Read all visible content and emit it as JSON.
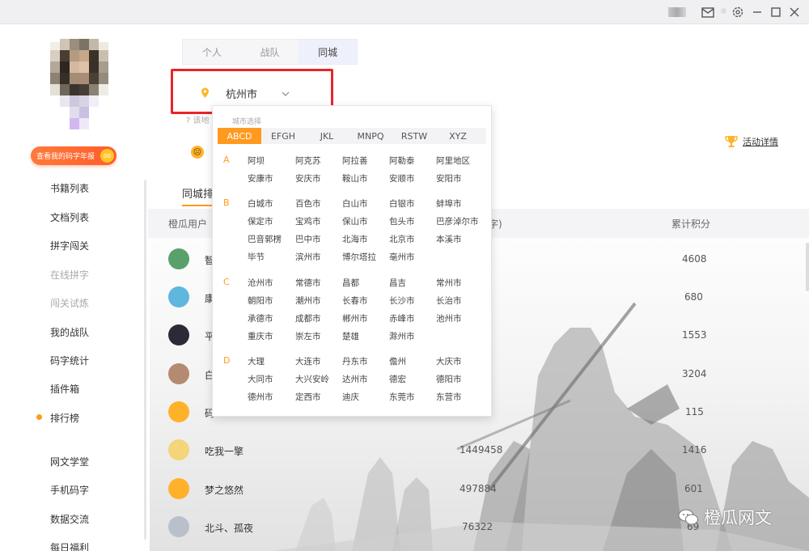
{
  "titlebar": {
    "icons": [
      "user-thumb-icon",
      "mail-icon",
      "settings-icon",
      "minimize-icon",
      "maximize-icon",
      "close-icon"
    ]
  },
  "sidebar": {
    "annual_report_label": "查看我的码字年报",
    "annual_badge": "00",
    "nav": [
      {
        "label": "书籍列表",
        "dim": false
      },
      {
        "label": "文档列表",
        "dim": false
      },
      {
        "label": "拼字闯关",
        "dim": false
      },
      {
        "label": "在线拼字",
        "dim": true
      },
      {
        "label": "闯关试炼",
        "dim": true
      },
      {
        "label": "我的战队",
        "dim": false
      },
      {
        "label": "码字统计",
        "dim": false
      },
      {
        "label": "插件箱",
        "dim": false
      },
      {
        "label": "排行榜",
        "dim": false,
        "active": true
      },
      {
        "label": "网文学堂",
        "dim": false
      },
      {
        "label": "手机码字",
        "dim": false
      },
      {
        "label": "数据交流",
        "dim": false
      },
      {
        "label": "每日福利",
        "dim": false
      }
    ]
  },
  "tabs": [
    {
      "label": "个人",
      "active": false
    },
    {
      "label": "战队",
      "active": false
    },
    {
      "label": "同城",
      "active": true
    }
  ],
  "city_select": {
    "value": "杭州市"
  },
  "hint_text": "? 该地   城市选择",
  "activity_link": "活动详情",
  "subtab_label": "同城排",
  "table": {
    "col_user": "橙瓜用户",
    "col_count": "字)",
    "col_score": "累计积分",
    "rows": [
      {
        "name": "智",
        "count": "5",
        "score": "4608",
        "avatar_color": "#5aa06a"
      },
      {
        "name": "康",
        "count": "",
        "score": "680",
        "avatar_color": "#5fb6de"
      },
      {
        "name": "平",
        "count": "",
        "score": "1553",
        "avatar_color": "#2b2b38"
      },
      {
        "name": "白",
        "count": "",
        "score": "3204",
        "avatar_color": "#b48a70"
      },
      {
        "name": "码",
        "count": "",
        "score": "115",
        "avatar_color": "#ffb12a"
      },
      {
        "name": "吃我一擎",
        "count": "1449458",
        "score": "1416",
        "avatar_color": "#f3d57a"
      },
      {
        "name": "梦之悠然",
        "count": "497884",
        "score": "601",
        "avatar_color": "#ffb12a"
      },
      {
        "name": "北斗、孤夜",
        "count": "76322",
        "score": "69",
        "avatar_color": "#b9c0cc"
      }
    ]
  },
  "dropdown": {
    "title": "城市选择",
    "letter_tabs": [
      {
        "label": "ABCD",
        "active": true
      },
      {
        "label": "EFGH",
        "active": false
      },
      {
        "label": "JKL",
        "active": false
      },
      {
        "label": "MNPQ",
        "active": false
      },
      {
        "label": "RSTW",
        "active": false
      },
      {
        "label": "XYZ",
        "active": false
      }
    ],
    "groups": [
      {
        "letter": "A",
        "rows": [
          [
            "阿坝",
            "阿克苏",
            "阿拉善",
            "阿勒泰",
            "阿里地区"
          ],
          [
            "安康市",
            "安庆市",
            "鞍山市",
            "安顺市",
            "安阳市"
          ]
        ]
      },
      {
        "letter": "B",
        "rows": [
          [
            "白城市",
            "百色市",
            "白山市",
            "白银市",
            "蚌埠市"
          ],
          [
            "保定市",
            "宝鸡市",
            "保山市",
            "包头市",
            "巴彦淖尔市"
          ],
          [
            "巴音郭楞",
            "巴中市",
            "北海市",
            "北京市",
            "本溪市"
          ],
          [
            "毕节",
            "滨州市",
            "博尔塔拉",
            "亳州市"
          ]
        ]
      },
      {
        "letter": "C",
        "rows": [
          [
            "沧州市",
            "常德市",
            "昌都",
            "昌吉",
            "常州市"
          ],
          [
            "朝阳市",
            "潮州市",
            "长春市",
            "长沙市",
            "长治市"
          ],
          [
            "承德市",
            "成都市",
            "郴州市",
            "赤峰市",
            "池州市"
          ],
          [
            "重庆市",
            "崇左市",
            "楚雄",
            "滁州市"
          ]
        ]
      },
      {
        "letter": "D",
        "rows": [
          [
            "大理",
            "大连市",
            "丹东市",
            "儋州",
            "大庆市"
          ],
          [
            "大同市",
            "大兴安岭",
            "达州市",
            "德宏",
            "德阳市"
          ],
          [
            "德州市",
            "定西市",
            "迪庆",
            "东莞市",
            "东营市"
          ]
        ]
      }
    ]
  },
  "watermark": "橙瓜网文"
}
